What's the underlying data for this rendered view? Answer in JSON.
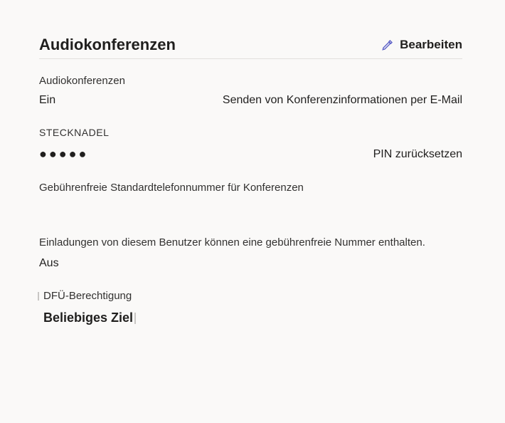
{
  "header": {
    "title": "Audiokonferenzen",
    "edit_label": "Bearbeiten"
  },
  "audioConferencing": {
    "label": "Audiokonferenzen",
    "value": "Ein",
    "sendInfoLabel": "Senden von Konferenzinformationen per E-Mail"
  },
  "pin": {
    "label": "STECKNADEL",
    "dots": "●●●●●",
    "resetLabel": "PIN zurücksetzen"
  },
  "tollFree": {
    "label": "Gebührenfreie Standardtelefonnummer für Konferenzen"
  },
  "invites": {
    "label": "Einladungen von diesem Benutzer können eine gebührenfreie Nummer enthalten.",
    "value": "Aus"
  },
  "dfu": {
    "label": "DFÜ-Berechtigung",
    "value": "Beliebiges Ziel"
  }
}
